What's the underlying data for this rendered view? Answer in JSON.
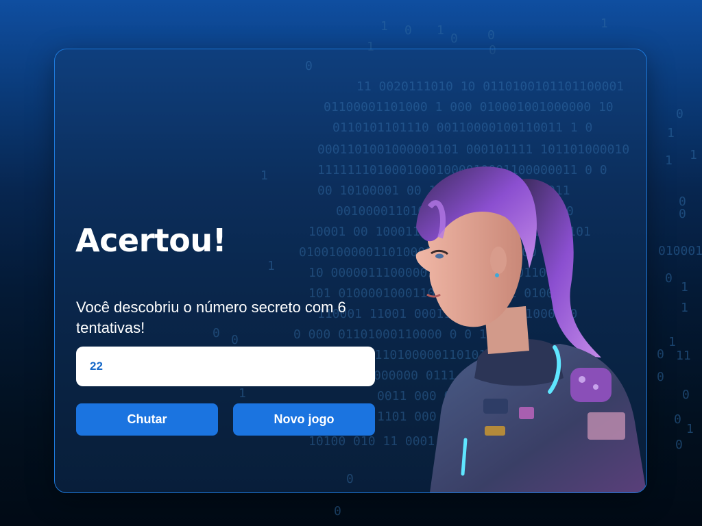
{
  "result": {
    "heading": "Acertou!",
    "message": "Você descobriu o número secreto com 6 tentativas!"
  },
  "guess_input": {
    "value": "22"
  },
  "buttons": {
    "guess_label": "Chutar",
    "new_game_label": "Novo jogo"
  },
  "colors": {
    "accent": "#1b74e0",
    "card_border": "#1d78d9",
    "input_text": "#1769c8",
    "hair": "#8b4fd0"
  }
}
